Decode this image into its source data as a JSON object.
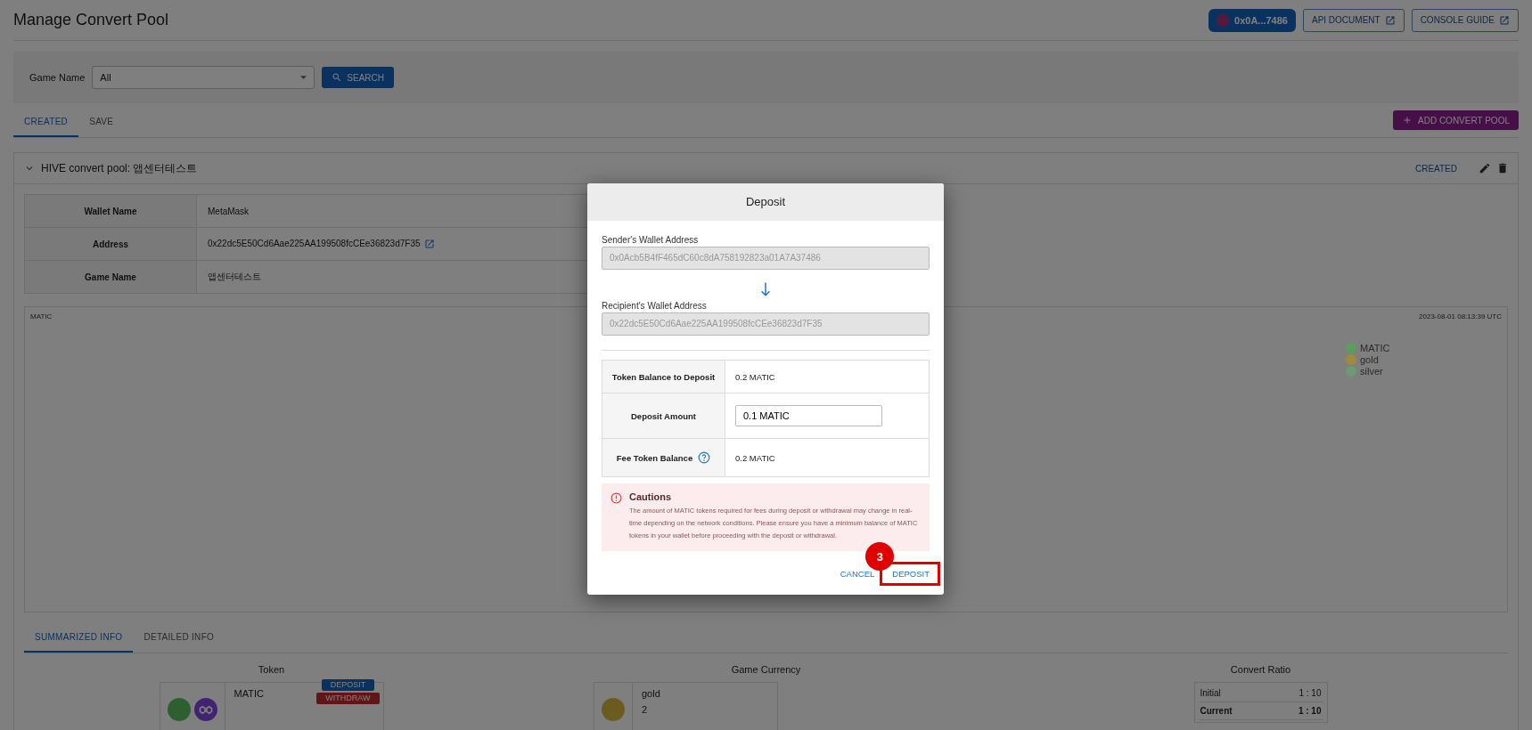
{
  "header": {
    "title": "Manage Convert Pool",
    "wallet_button": "0x0A...7486",
    "link_buttons": [
      "API DOCUMENT",
      "CONSOLE GUIDE"
    ]
  },
  "filter": {
    "label": "Game Name",
    "value": "All",
    "search_button": "SEARCH"
  },
  "tabs": [
    {
      "label": "CREATED",
      "selected": true
    },
    {
      "label": "SAVE",
      "selected": false
    }
  ],
  "add_button": "ADD CONVERT POOL",
  "pool": {
    "title": "HIVE convert pool: 앱센터테스트",
    "expanded": true,
    "status": "CREATED",
    "info_rows": [
      {
        "label": "Wallet Name",
        "value": "MetaMask",
        "kind": "text"
      },
      {
        "label": "Address",
        "value": "0x22dc5E50Cd6Aae225AA199508fcCEe36823d7F35",
        "kind": "link"
      },
      {
        "label": "Game Name",
        "value": "앱센터테스트",
        "kind": "text"
      }
    ],
    "chart_panel": {
      "token_label": "MATIC",
      "timestamp": "2023-08-01 08:13:39 UTC",
      "legend": [
        {
          "label": "MATIC",
          "color": "#5a9e5e"
        },
        {
          "label": "gold",
          "color": "#a08a3c"
        },
        {
          "label": "silver",
          "color": "#6e9a6f"
        }
      ]
    },
    "sub_tabs": [
      {
        "label": "SUMMARIZED INFO",
        "selected": true
      },
      {
        "label": "DETAILED INFO",
        "selected": false
      }
    ],
    "summary": {
      "token_heading": "Token",
      "currency_heading": "Game Currency",
      "ratio_heading": "Convert Ratio",
      "token": {
        "name": "MATIC",
        "deposit_button": "DEPOSIT",
        "withdraw_button": "WITHDRAW"
      },
      "currency": {
        "name": "gold",
        "amount": "2"
      },
      "ratio_rows": [
        {
          "label": "Initial",
          "value": "1 : 10",
          "emphasized": false
        },
        {
          "label": "Current",
          "value": "1 : 10",
          "emphasized": true
        }
      ]
    }
  },
  "modal": {
    "title": "Deposit",
    "sender_label": "Sender's Wallet Address",
    "sender_value": "0x0Acb5B4fF465dC60c8dA758192823a01A7A37486",
    "recipient_label": "Recipient's Wallet Address",
    "recipient_value": "0x22dc5E50Cd6Aae225AA199508fcCEe36823d7F35",
    "rows": [
      {
        "label": "Token Balance to Deposit",
        "value": "0.2 MATIC",
        "kind": "text",
        "help": false
      },
      {
        "label": "Deposit Amount",
        "value": "0.1 MATIC",
        "kind": "input",
        "help": false
      },
      {
        "label": "Fee Token Balance",
        "value": "0.2 MATIC",
        "kind": "text",
        "help": true
      }
    ],
    "caution_title": "Cautions",
    "caution_text": "The amount of MATIC tokens required for fees during deposit or withdrawal may change in real-time depending on the network conditions. Please ensure you have a minimum balance of MATIC tokens in your wallet before proceeding with the deposit or withdrawal.",
    "cancel_button": "CANCEL",
    "deposit_button": "DEPOSIT",
    "step_badge": "3"
  }
}
